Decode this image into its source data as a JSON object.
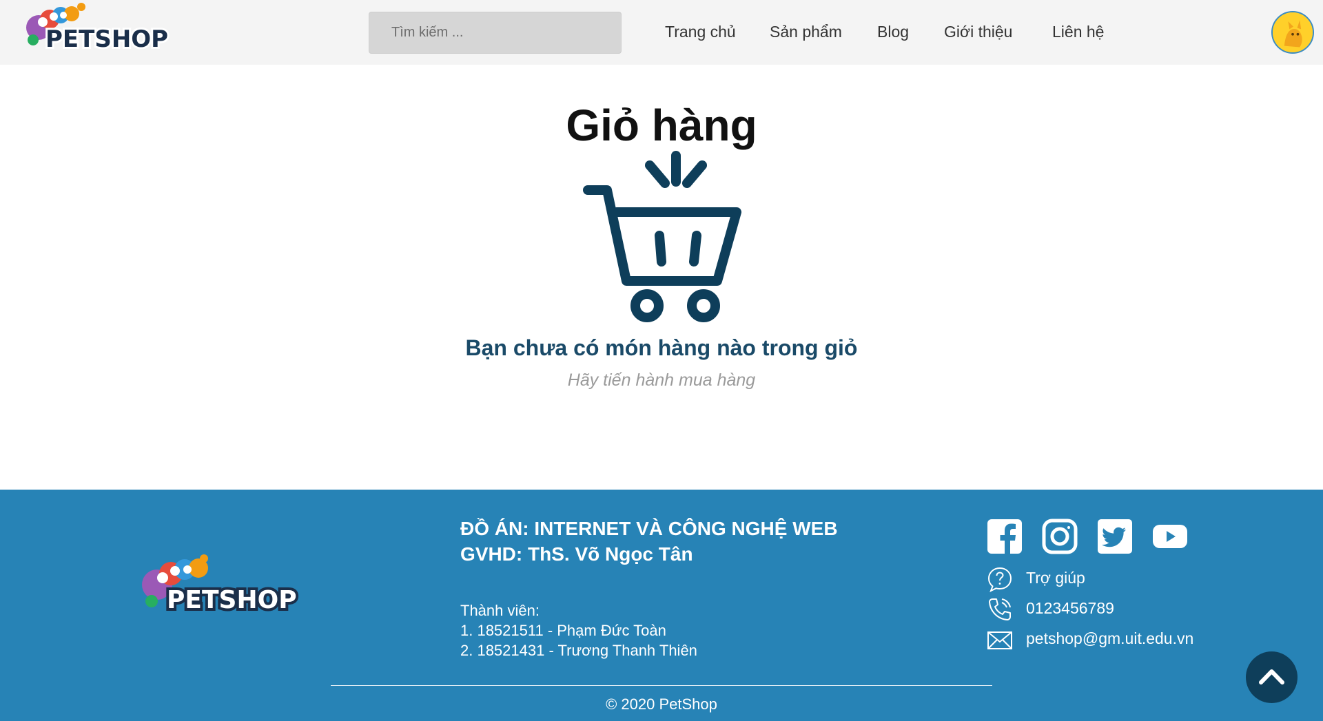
{
  "header": {
    "search_placeholder": "Tìm kiếm ...",
    "nav": [
      "Trang chủ",
      "Sản phẩm",
      "Blog",
      "Giới thiệu",
      "Liên hệ"
    ],
    "logo_text": "PETSHOP"
  },
  "main": {
    "title": "Giỏ hàng",
    "empty_message": "Bạn chưa có món hàng nào trong giỏ",
    "empty_sub": "Hãy tiến hành mua hàng"
  },
  "footer": {
    "logo_text": "PETSHOP",
    "project_line1": "ĐỒ ÁN: INTERNET VÀ CÔNG NGHỆ WEB",
    "project_line2": "GVHD: ThS. Võ Ngọc Tân",
    "members_label": "Thành viên:",
    "member1": "1. 18521511 - Phạm Đức Toàn",
    "member2": "2. 18521431 - Trương Thanh Thiên",
    "help": "Trợ giúp",
    "phone": "0123456789",
    "email": "petshop@gm.uit.edu.vn",
    "copyright": "© 2020 PetShop",
    "socials": [
      "facebook-icon",
      "instagram-icon",
      "twitter-icon",
      "youtube-icon"
    ]
  },
  "colors": {
    "header_bg": "#f4f4f4",
    "footer_bg": "#2783b6",
    "cart_blue": "#0e3e5a",
    "message_blue": "#1a4a68"
  }
}
